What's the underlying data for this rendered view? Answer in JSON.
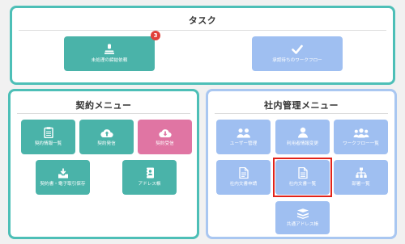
{
  "task": {
    "title": "タスク",
    "items": [
      {
        "label": "未処理の締結依頼",
        "icon": "stamp-icon",
        "badge": "3"
      },
      {
        "label": "承認待ちのワークフロー",
        "icon": "check-icon"
      }
    ]
  },
  "contract_menu": {
    "title": "契約メニュー",
    "items": [
      {
        "label": "契約情報一覧",
        "icon": "clipboard-icon"
      },
      {
        "label": "契約発信",
        "icon": "cloud-upload-icon"
      },
      {
        "label": "契約受信",
        "icon": "cloud-download-icon"
      },
      {
        "label": "契約書・電子取引保存",
        "icon": "inbox-download-icon"
      },
      {
        "label": "アドレス帳",
        "icon": "address-book-icon"
      }
    ]
  },
  "internal_menu": {
    "title": "社内管理メニュー",
    "items": [
      {
        "label": "ユーザー管理",
        "icon": "users-icon"
      },
      {
        "label": "利用者情報変更",
        "icon": "user-icon"
      },
      {
        "label": "ワークフロー一覧",
        "icon": "group-icon"
      },
      {
        "label": "社内文書申請",
        "icon": "document-edit-icon"
      },
      {
        "label": "社内文書一覧",
        "icon": "document-icon"
      },
      {
        "label": "部署一覧",
        "icon": "org-chart-icon"
      },
      {
        "label": "共通アドレス帳",
        "icon": "books-icon"
      }
    ]
  },
  "colors": {
    "teal": "#4ab3a9",
    "pink": "#e075a3",
    "light_blue": "#9fbff1",
    "badge_red": "#e0413a",
    "highlight_red": "#e2231a"
  }
}
